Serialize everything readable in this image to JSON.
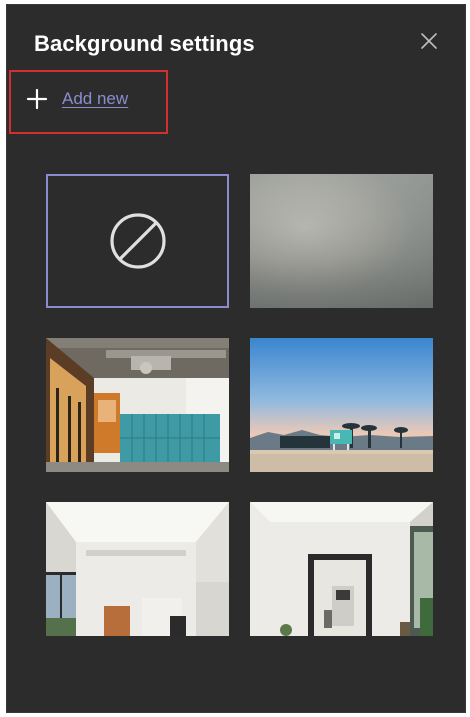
{
  "panel": {
    "title": "Background settings",
    "add_new_label": "Add new"
  },
  "icons": {
    "close": "close-icon",
    "add": "plus-icon",
    "none": "no-background-icon"
  },
  "backgrounds": [
    {
      "id": "none",
      "kind": "none",
      "selected": true
    },
    {
      "id": "blur",
      "kind": "blur",
      "selected": false
    },
    {
      "id": "office",
      "kind": "image",
      "selected": false
    },
    {
      "id": "beach",
      "kind": "image",
      "selected": false
    },
    {
      "id": "room-1",
      "kind": "image",
      "selected": false
    },
    {
      "id": "room-2",
      "kind": "image",
      "selected": false
    }
  ],
  "colors": {
    "panel_bg": "#2d2c2c",
    "accent": "#8b8ccf",
    "highlight_box": "#d32f2f",
    "text": "#ffffff"
  }
}
